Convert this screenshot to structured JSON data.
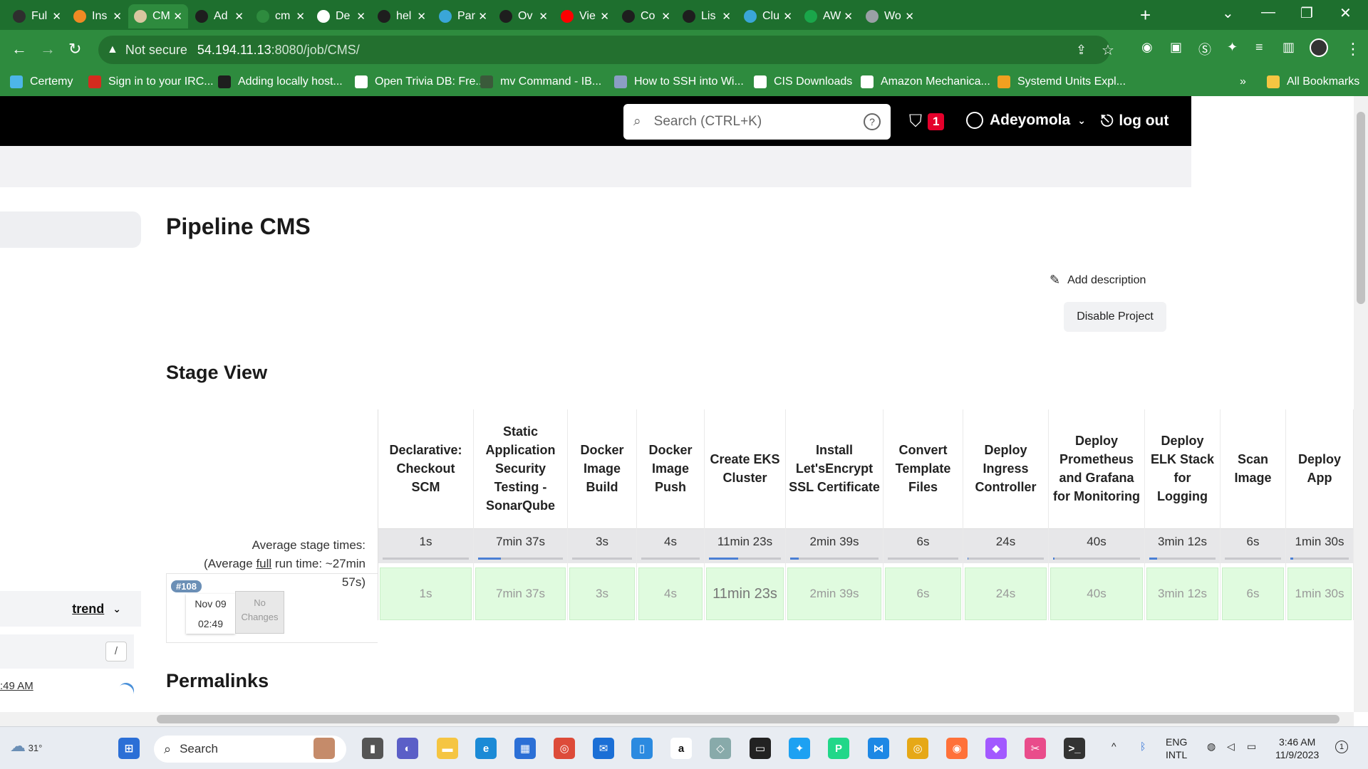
{
  "browser": {
    "tabs": [
      {
        "label": "Ful",
        "icon": "openai-icon",
        "color": "#2e2e2e"
      },
      {
        "label": "Ins",
        "icon": "box-icon",
        "color": "#f08a24"
      },
      {
        "label": "CM",
        "icon": "jenkins-icon",
        "color": "#d9c6a0",
        "active": true
      },
      {
        "label": "Ad",
        "icon": "github-icon",
        "color": "#1e1e1e"
      },
      {
        "label": "cm",
        "icon": "wave-icon",
        "color": "#2e8b3e"
      },
      {
        "label": "De",
        "icon": "docker-icon",
        "color": "#ffffff"
      },
      {
        "label": "hel",
        "icon": "github-icon",
        "color": "#1e1e1e"
      },
      {
        "label": "Par",
        "icon": "ball-icon",
        "color": "#3aa6d8"
      },
      {
        "label": "Ov",
        "icon": "github-icon",
        "color": "#1e1e1e"
      },
      {
        "label": "Vie",
        "icon": "youtube-icon",
        "color": "#ff0000"
      },
      {
        "label": "Co",
        "icon": "github-icon",
        "color": "#1e1e1e"
      },
      {
        "label": "Lis",
        "icon": "github-icon",
        "color": "#1e1e1e"
      },
      {
        "label": "Clu",
        "icon": "ball-icon",
        "color": "#3aa6d8"
      },
      {
        "label": "AW",
        "icon": "w-icon",
        "color": "#1aa64a"
      },
      {
        "label": "Wo",
        "icon": "globe-icon",
        "color": "#9aa0a6"
      }
    ],
    "omnibox": {
      "security": "Not secure",
      "url_host": "54.194.11.13",
      "url_path": ":8080/job/CMS/"
    },
    "bookmarks": [
      {
        "label": "Certemy",
        "color": "#4db6e8"
      },
      {
        "label": "Sign in to your IRC...",
        "color": "#d52b1e"
      },
      {
        "label": "Adding locally host...",
        "color": "#1e1e1e"
      },
      {
        "label": "Open Trivia DB: Fre...",
        "color": "#ffffff"
      },
      {
        "label": "mv Command - IB...",
        "color": "#3a5a3a"
      },
      {
        "label": "How to SSH into Wi...",
        "color": "#8b9ec4"
      },
      {
        "label": "CIS Downloads",
        "color": "#ffffff"
      },
      {
        "label": "Amazon Mechanica...",
        "color": "#ffffff"
      },
      {
        "label": "Systemd Units Expl...",
        "color": "#f0a020"
      }
    ],
    "all_bookmarks": "All Bookmarks"
  },
  "jenkins": {
    "search_placeholder": "Search (CTRL+K)",
    "security_count": "1",
    "user": "Adeyomola",
    "logout": "log out",
    "page_title": "Pipeline CMS",
    "add_description": "Add description",
    "disable_project": "Disable Project",
    "stage_view_title": "Stage View",
    "avg_stage_times": "Average stage times:",
    "avg_full_prefix": "(Average ",
    "avg_full_word": "full",
    "avg_full_suffix": " run time: ~27min 57s)",
    "build": {
      "number": "#108",
      "date": "Nov 09",
      "time": "02:49",
      "changes": "No Changes"
    },
    "trend": "trend",
    "slash_key": "/",
    "perm_time": ":49 AM",
    "permalinks": "Permalinks",
    "stages": [
      {
        "name": "Declarative: Checkout SCM",
        "avg": "1s",
        "run": "1s",
        "progress": 0.0
      },
      {
        "name": "Static Application Security Testing - SonarQube",
        "avg": "7min 37s",
        "run": "7min 37s",
        "progress": 0.27
      },
      {
        "name": "Docker Image Build",
        "avg": "3s",
        "run": "3s",
        "progress": 0.0
      },
      {
        "name": "Docker Image Push",
        "avg": "4s",
        "run": "4s",
        "progress": 0.0
      },
      {
        "name": "Create EKS Cluster",
        "avg": "11min 23s",
        "run": "11min 23s",
        "progress": 0.41
      },
      {
        "name": "Install Let'sEncrypt SSL Certificate",
        "avg": "2min 39s",
        "run": "2min 39s",
        "progress": 0.1
      },
      {
        "name": "Convert Template Files",
        "avg": "6s",
        "run": "6s",
        "progress": 0.0
      },
      {
        "name": "Deploy Ingress Controller",
        "avg": "24s",
        "run": "24s",
        "progress": 0.01
      },
      {
        "name": "Deploy Prometheus and Grafana for Monitoring",
        "avg": "40s",
        "run": "40s",
        "progress": 0.02
      },
      {
        "name": "Deploy ELK Stack for Logging",
        "avg": "3min 12s",
        "run": "3min 12s",
        "progress": 0.12
      },
      {
        "name": "Scan Image",
        "avg": "6s",
        "run": "6s",
        "progress": 0.0
      },
      {
        "name": "Deploy App",
        "avg": "1min 30s",
        "run": "1min 30s",
        "progress": 0.05
      }
    ]
  },
  "taskbar": {
    "weather": "31°",
    "search": "Search",
    "lang1": "ENG",
    "lang2": "INTL",
    "time": "3:46 AM",
    "date": "11/9/2023",
    "notif": "1"
  }
}
